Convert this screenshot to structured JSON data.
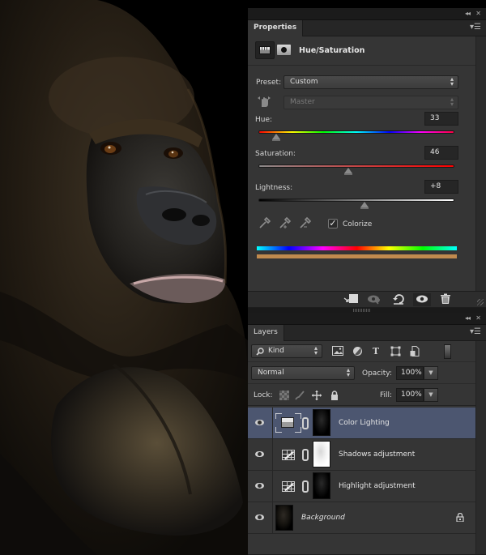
{
  "canvas": {
    "subject": "gorilla-portrait-photo"
  },
  "properties_panel": {
    "tab_label": "Properties",
    "collapse_icon": "collapse-panel-icon",
    "close_icon": "close-icon",
    "menu_icon": "panel-menu-icon",
    "adjustment_title": "Hue/Saturation",
    "preset_label": "Preset:",
    "preset_value": "Custom",
    "channel_value": "Master",
    "hue": {
      "label": "Hue:",
      "value": "33",
      "fraction": 0.09
    },
    "saturation": {
      "label": "Saturation:",
      "value": "46",
      "fraction": 0.46
    },
    "lightness": {
      "label": "Lightness:",
      "value": "+8",
      "fraction": 0.54
    },
    "colorize": {
      "label": "Colorize",
      "checked": true
    },
    "colorize_tint": "#c08a4e",
    "footer_icons": [
      "clip-to-layer-icon",
      "view-previous-state-icon",
      "reset-icon",
      "toggle-visibility-icon",
      "delete-icon"
    ]
  },
  "layers_panel": {
    "tab_label": "Layers",
    "filter_kind": "Kind",
    "blend_mode": "Normal",
    "opacity_label": "Opacity:",
    "opacity_value": "100%",
    "lock_label": "Lock:",
    "fill_label": "Fill:",
    "fill_value": "100%",
    "layers": [
      {
        "name": "Color Lighting",
        "type": "hue-saturation",
        "selected": true,
        "visible": true
      },
      {
        "name": "Shadows adjustment",
        "type": "curves",
        "selected": false,
        "visible": true
      },
      {
        "name": "Highlight adjustment",
        "type": "curves",
        "selected": false,
        "visible": true
      },
      {
        "name": "Background",
        "type": "background",
        "selected": false,
        "visible": true,
        "locked": true
      }
    ]
  },
  "colors": {
    "selected_layer": "#4c5670",
    "panel_bg": "#353535"
  }
}
